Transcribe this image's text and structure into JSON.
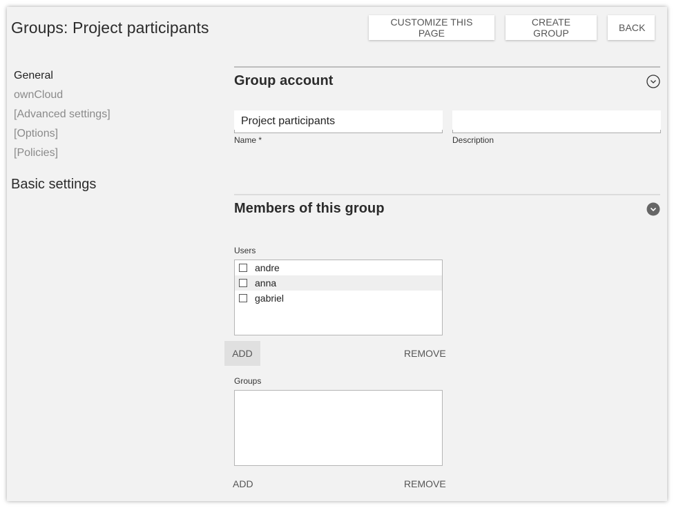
{
  "header": {
    "title": "Groups: Project participants",
    "buttons": {
      "customize": "CUSTOMIZE THIS PAGE",
      "create_group": "CREATE GROUP",
      "back": "BACK"
    }
  },
  "sidebar": {
    "items": [
      {
        "label": "General",
        "active": true
      },
      {
        "label": "ownCloud",
        "active": false
      },
      {
        "label": "[Advanced settings]",
        "active": false
      },
      {
        "label": "[Options]",
        "active": false
      },
      {
        "label": "[Policies]",
        "active": false
      }
    ],
    "heading": "Basic settings"
  },
  "group_account": {
    "title": "Group account",
    "toggle_icon": "chevron-circle-down-outline-icon",
    "name_field": {
      "value": "Project participants",
      "label": "Name *"
    },
    "description_field": {
      "value": "",
      "label": "Description"
    }
  },
  "members": {
    "title": "Members of this group",
    "toggle_icon": "chevron-circle-down-filled-icon",
    "users": {
      "label": "Users",
      "items": [
        {
          "name": "andre",
          "checked": false
        },
        {
          "name": "anna",
          "checked": false
        },
        {
          "name": "gabriel",
          "checked": false
        }
      ],
      "add_label": "ADD",
      "remove_label": "REMOVE"
    },
    "groups": {
      "label": "Groups",
      "items": [],
      "add_label": "ADD",
      "remove_label": "REMOVE"
    }
  }
}
